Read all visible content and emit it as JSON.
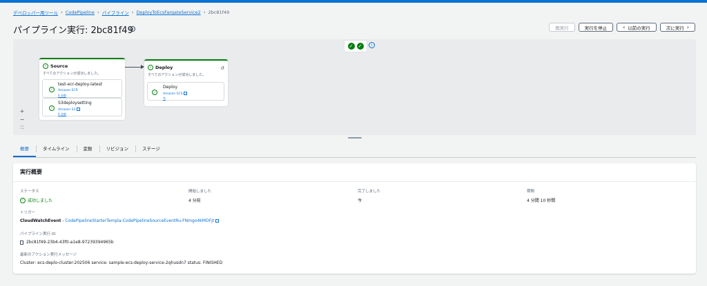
{
  "breadcrumb": [
    "デベロッパー用ツール",
    "CodePipeline",
    "パイプライン",
    "DeployToEcsFargateService2",
    "2bc81f49"
  ],
  "page_title": "パイプライン実行: 2bc81f49",
  "actions": {
    "retry": "再実行",
    "stop": "実行を停止",
    "prev": "以前の実行",
    "next": "次に実行"
  },
  "icons": {
    "chevron_left": "‹",
    "chevron_right": "›",
    "check": "✓",
    "info": "i",
    "retry": "↺",
    "zoom_in": "+",
    "zoom_out": "−",
    "fit": "⛶"
  },
  "colors": {
    "accent": "#0972d3",
    "success": "#037f0c"
  },
  "stages": [
    {
      "name": "Source",
      "desc": "すべてのアクションが成功しました。",
      "actions": [
        {
          "name": "test-ecr-deploy-latest",
          "provider": "Amazon ECR",
          "time": "4 分前"
        },
        {
          "name": "S3deploysetting",
          "provider": "Amazon S3",
          "time": "4 分前"
        }
      ]
    },
    {
      "name": "Deploy",
      "desc": "すべてのアクションが成功しました。",
      "actions": [
        {
          "name": "Deploy",
          "provider": "Amazon ECS",
          "time": "今"
        }
      ]
    }
  ],
  "tabs": [
    "概要",
    "タイムライン",
    "変数",
    "リビジョン",
    "ステージ"
  ],
  "summary": {
    "header": "実行概要",
    "status_label": "ステータス",
    "status_value": "成功しました",
    "started_label": "開始しました",
    "started_value": "4 分前",
    "completed_label": "完了しました",
    "completed_value": "今",
    "duration_label": "期間",
    "duration_value": "4 分間 10 秒間",
    "trigger_label": "トリガー",
    "trigger_type": "CloudWatchEvent",
    "trigger_sep": " - ",
    "trigger_link": "CodePipelineStarterTempla-CodePipelineSourceEventRu-FNmgo4kMOFjt",
    "exec_id_label": "パイプライン実行 ID",
    "exec_id_value": "2bc81f49-23b4-43f0-a1e8-97239394965b",
    "message_label": "最新のアクション実行メッセージ",
    "message_value": "Cluster: ecs-deplo-cluster-202506 service: sample-ecs-deploy-service-2qhusdn7 status: FINISHED"
  }
}
